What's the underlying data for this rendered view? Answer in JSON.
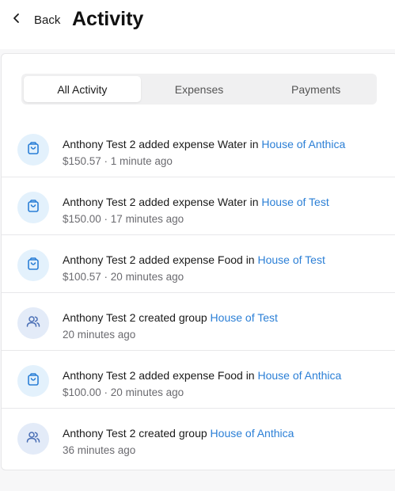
{
  "header": {
    "back_label": "Back",
    "title": "Activity"
  },
  "tabs": [
    {
      "label": "All Activity",
      "active": true
    },
    {
      "label": "Expenses",
      "active": false
    },
    {
      "label": "Payments",
      "active": false
    }
  ],
  "colors": {
    "link": "#2b7fd6",
    "expense_icon": "#2b7fd6",
    "expense_bg": "#e3f1fc",
    "group_icon": "#4a6fb5",
    "group_bg": "#e3ebf8"
  },
  "activities": [
    {
      "icon": "shopping-bag-icon",
      "text": "Anthony Test 2 added expense Water in ",
      "group": "House of Anthica",
      "meta": "$150.57 · 1 minute ago"
    },
    {
      "icon": "shopping-bag-icon",
      "text": "Anthony Test 2 added expense Water in ",
      "group": "House of Test",
      "meta": "$150.00 · 17 minutes ago"
    },
    {
      "icon": "shopping-bag-icon",
      "text": "Anthony Test 2 added expense Food in ",
      "group": "House of Test",
      "meta": "$100.57 · 20 minutes ago"
    },
    {
      "icon": "users-icon",
      "text": "Anthony Test 2 created group ",
      "group": "House of Test",
      "meta": "20 minutes ago"
    },
    {
      "icon": "shopping-bag-icon",
      "text": "Anthony Test 2 added expense Food in ",
      "group": "House of Anthica",
      "meta": "$100.00 · 20 minutes ago"
    },
    {
      "icon": "users-icon",
      "text": "Anthony Test 2 created group ",
      "group": "House of Anthica",
      "meta": "36 minutes ago"
    }
  ]
}
